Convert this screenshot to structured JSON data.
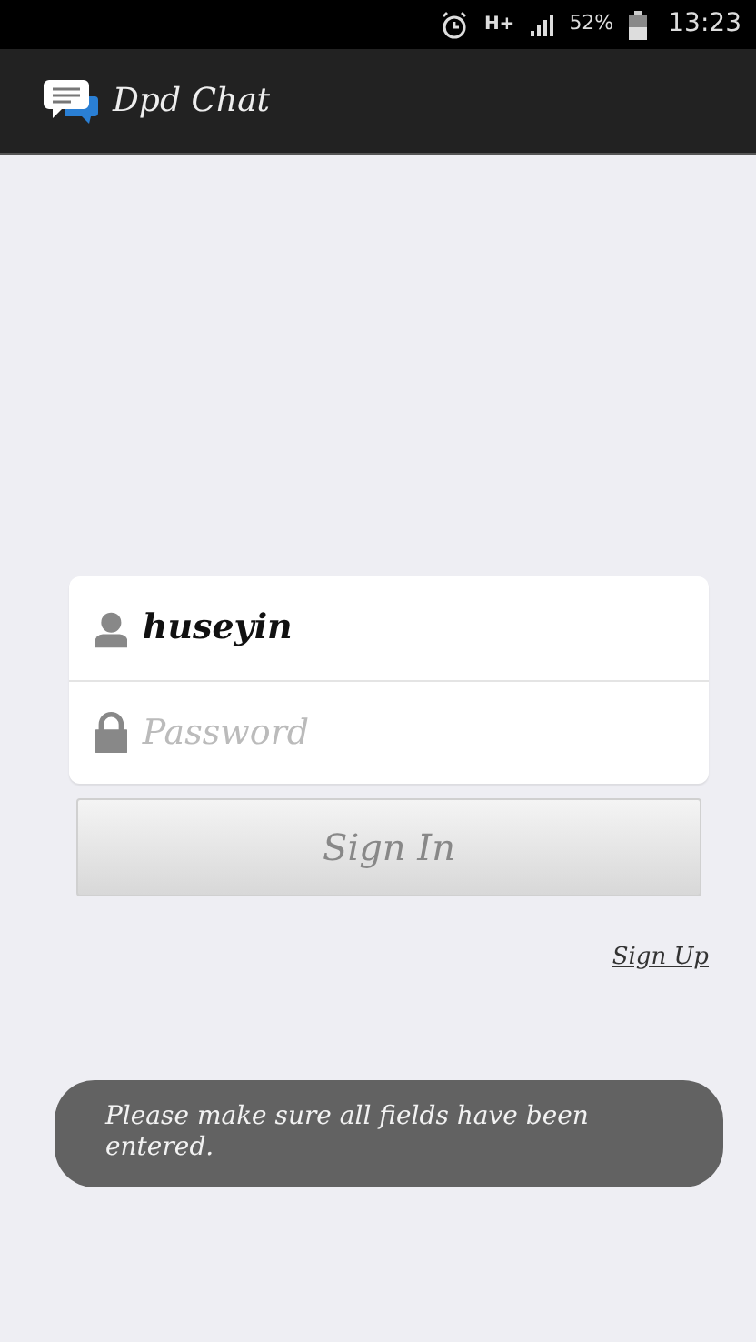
{
  "status_bar": {
    "network": "H+",
    "battery": "52%",
    "time": "13:23"
  },
  "app_bar": {
    "title": "Dpd Chat"
  },
  "login": {
    "username": {
      "value": "huseyin"
    },
    "password": {
      "placeholder": "Password"
    },
    "sign_in_button": "Sign In",
    "sign_up_link": "Sign Up"
  },
  "toast": {
    "message": "Please make sure all fields have been entered."
  }
}
